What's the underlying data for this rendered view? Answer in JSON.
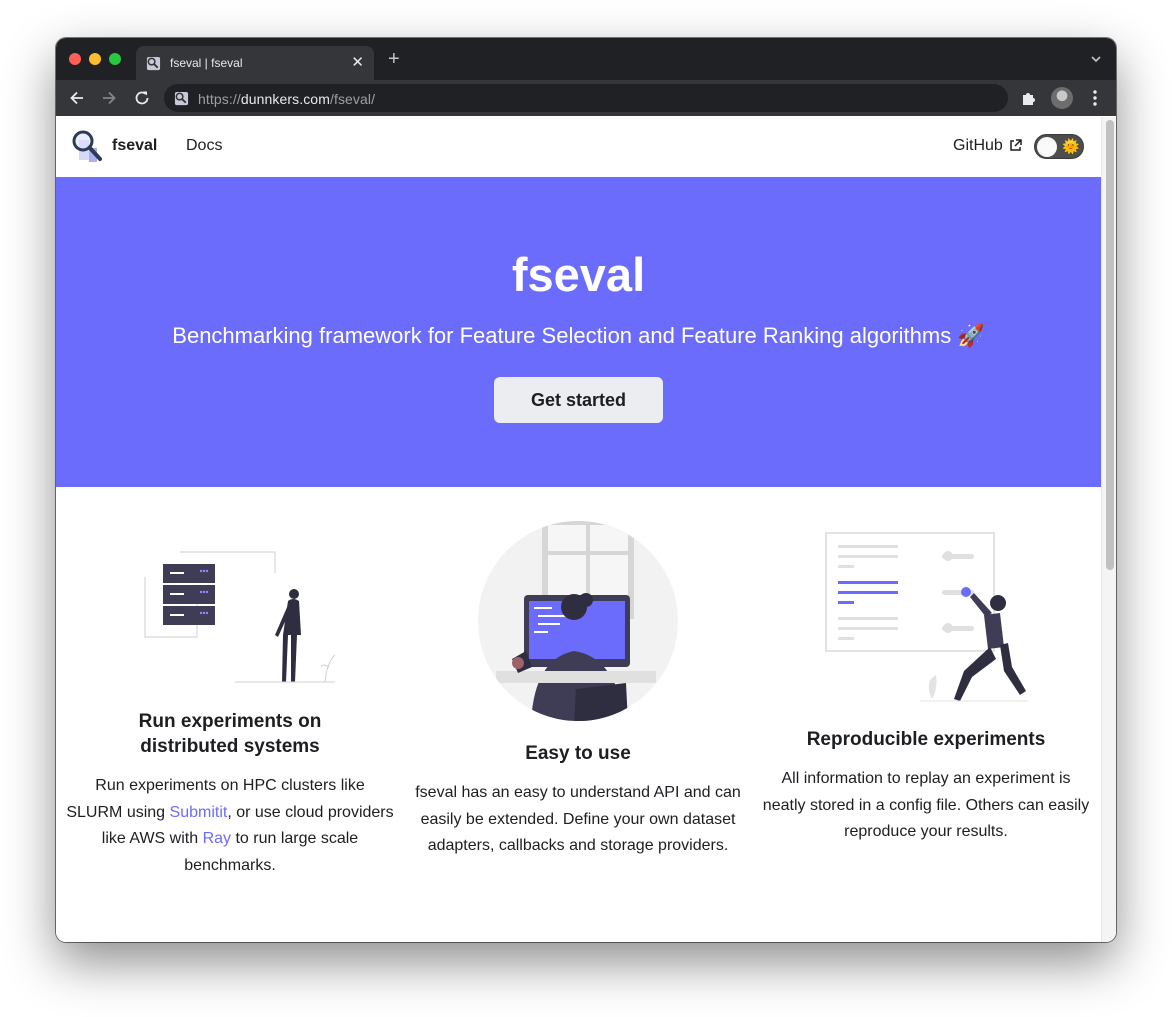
{
  "browser": {
    "tab_title": "fseval | fseval",
    "new_tab_symbol": "+",
    "close_symbol": "✕",
    "url_scheme": "https://",
    "url_host": "dunnkers.com",
    "url_path": "/fseval/"
  },
  "navbar": {
    "brand": "fseval",
    "docs": "Docs",
    "github": "GitHub",
    "theme_icon": "🌞"
  },
  "hero": {
    "title": "fseval",
    "subtitle": "Benchmarking framework for Feature Selection and Feature Ranking algorithms 🚀",
    "cta": "Get started",
    "background": "#6c6cfc"
  },
  "features": [
    {
      "title": "Run experiments on distributed systems",
      "desc_1": "Run experiments on HPC clusters like SLURM using ",
      "link_1": "Submitit",
      "desc_2": ", or use cloud providers like AWS with ",
      "link_2": "Ray",
      "desc_3": " to run large scale benchmarks."
    },
    {
      "title": "Easy to use",
      "desc": "fseval has an easy to understand API and can easily be extended. Define your own dataset adapters, callbacks and storage providers."
    },
    {
      "title": "Reproducible experiments",
      "desc": "All information to replay an experiment is neatly stored in a config file. Others can easily reproduce your results."
    }
  ],
  "icons": {
    "back": "arrow-left-icon",
    "forward": "arrow-right-icon",
    "reload": "reload-icon",
    "site": "site-info-icon",
    "extensions": "puzzle-icon",
    "menu": "kebab-menu-icon",
    "external": "external-link-icon"
  }
}
